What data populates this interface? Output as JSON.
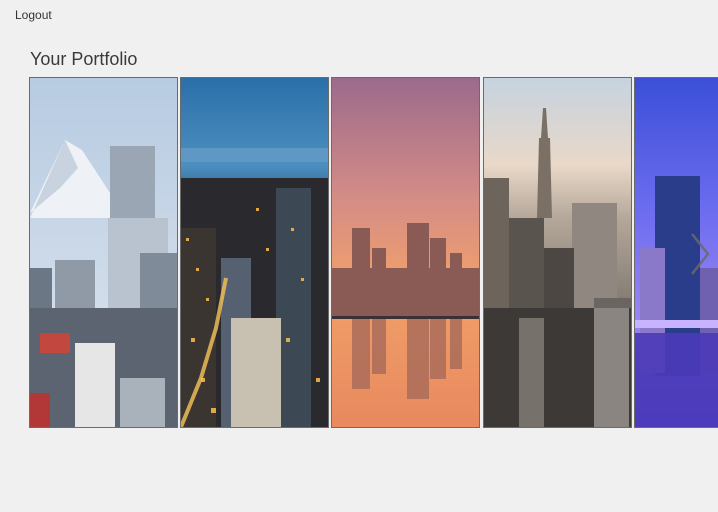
{
  "header": {
    "logout_label": "Logout"
  },
  "portfolio": {
    "title": "Your Portfolio",
    "cards": [
      {
        "name": "city-tokyo-fuji"
      },
      {
        "name": "city-night-lights"
      },
      {
        "name": "city-sunset-reflection"
      },
      {
        "name": "city-new-york"
      },
      {
        "name": "city-blue-dusk"
      }
    ],
    "next_icon": "chevron-right-icon"
  }
}
